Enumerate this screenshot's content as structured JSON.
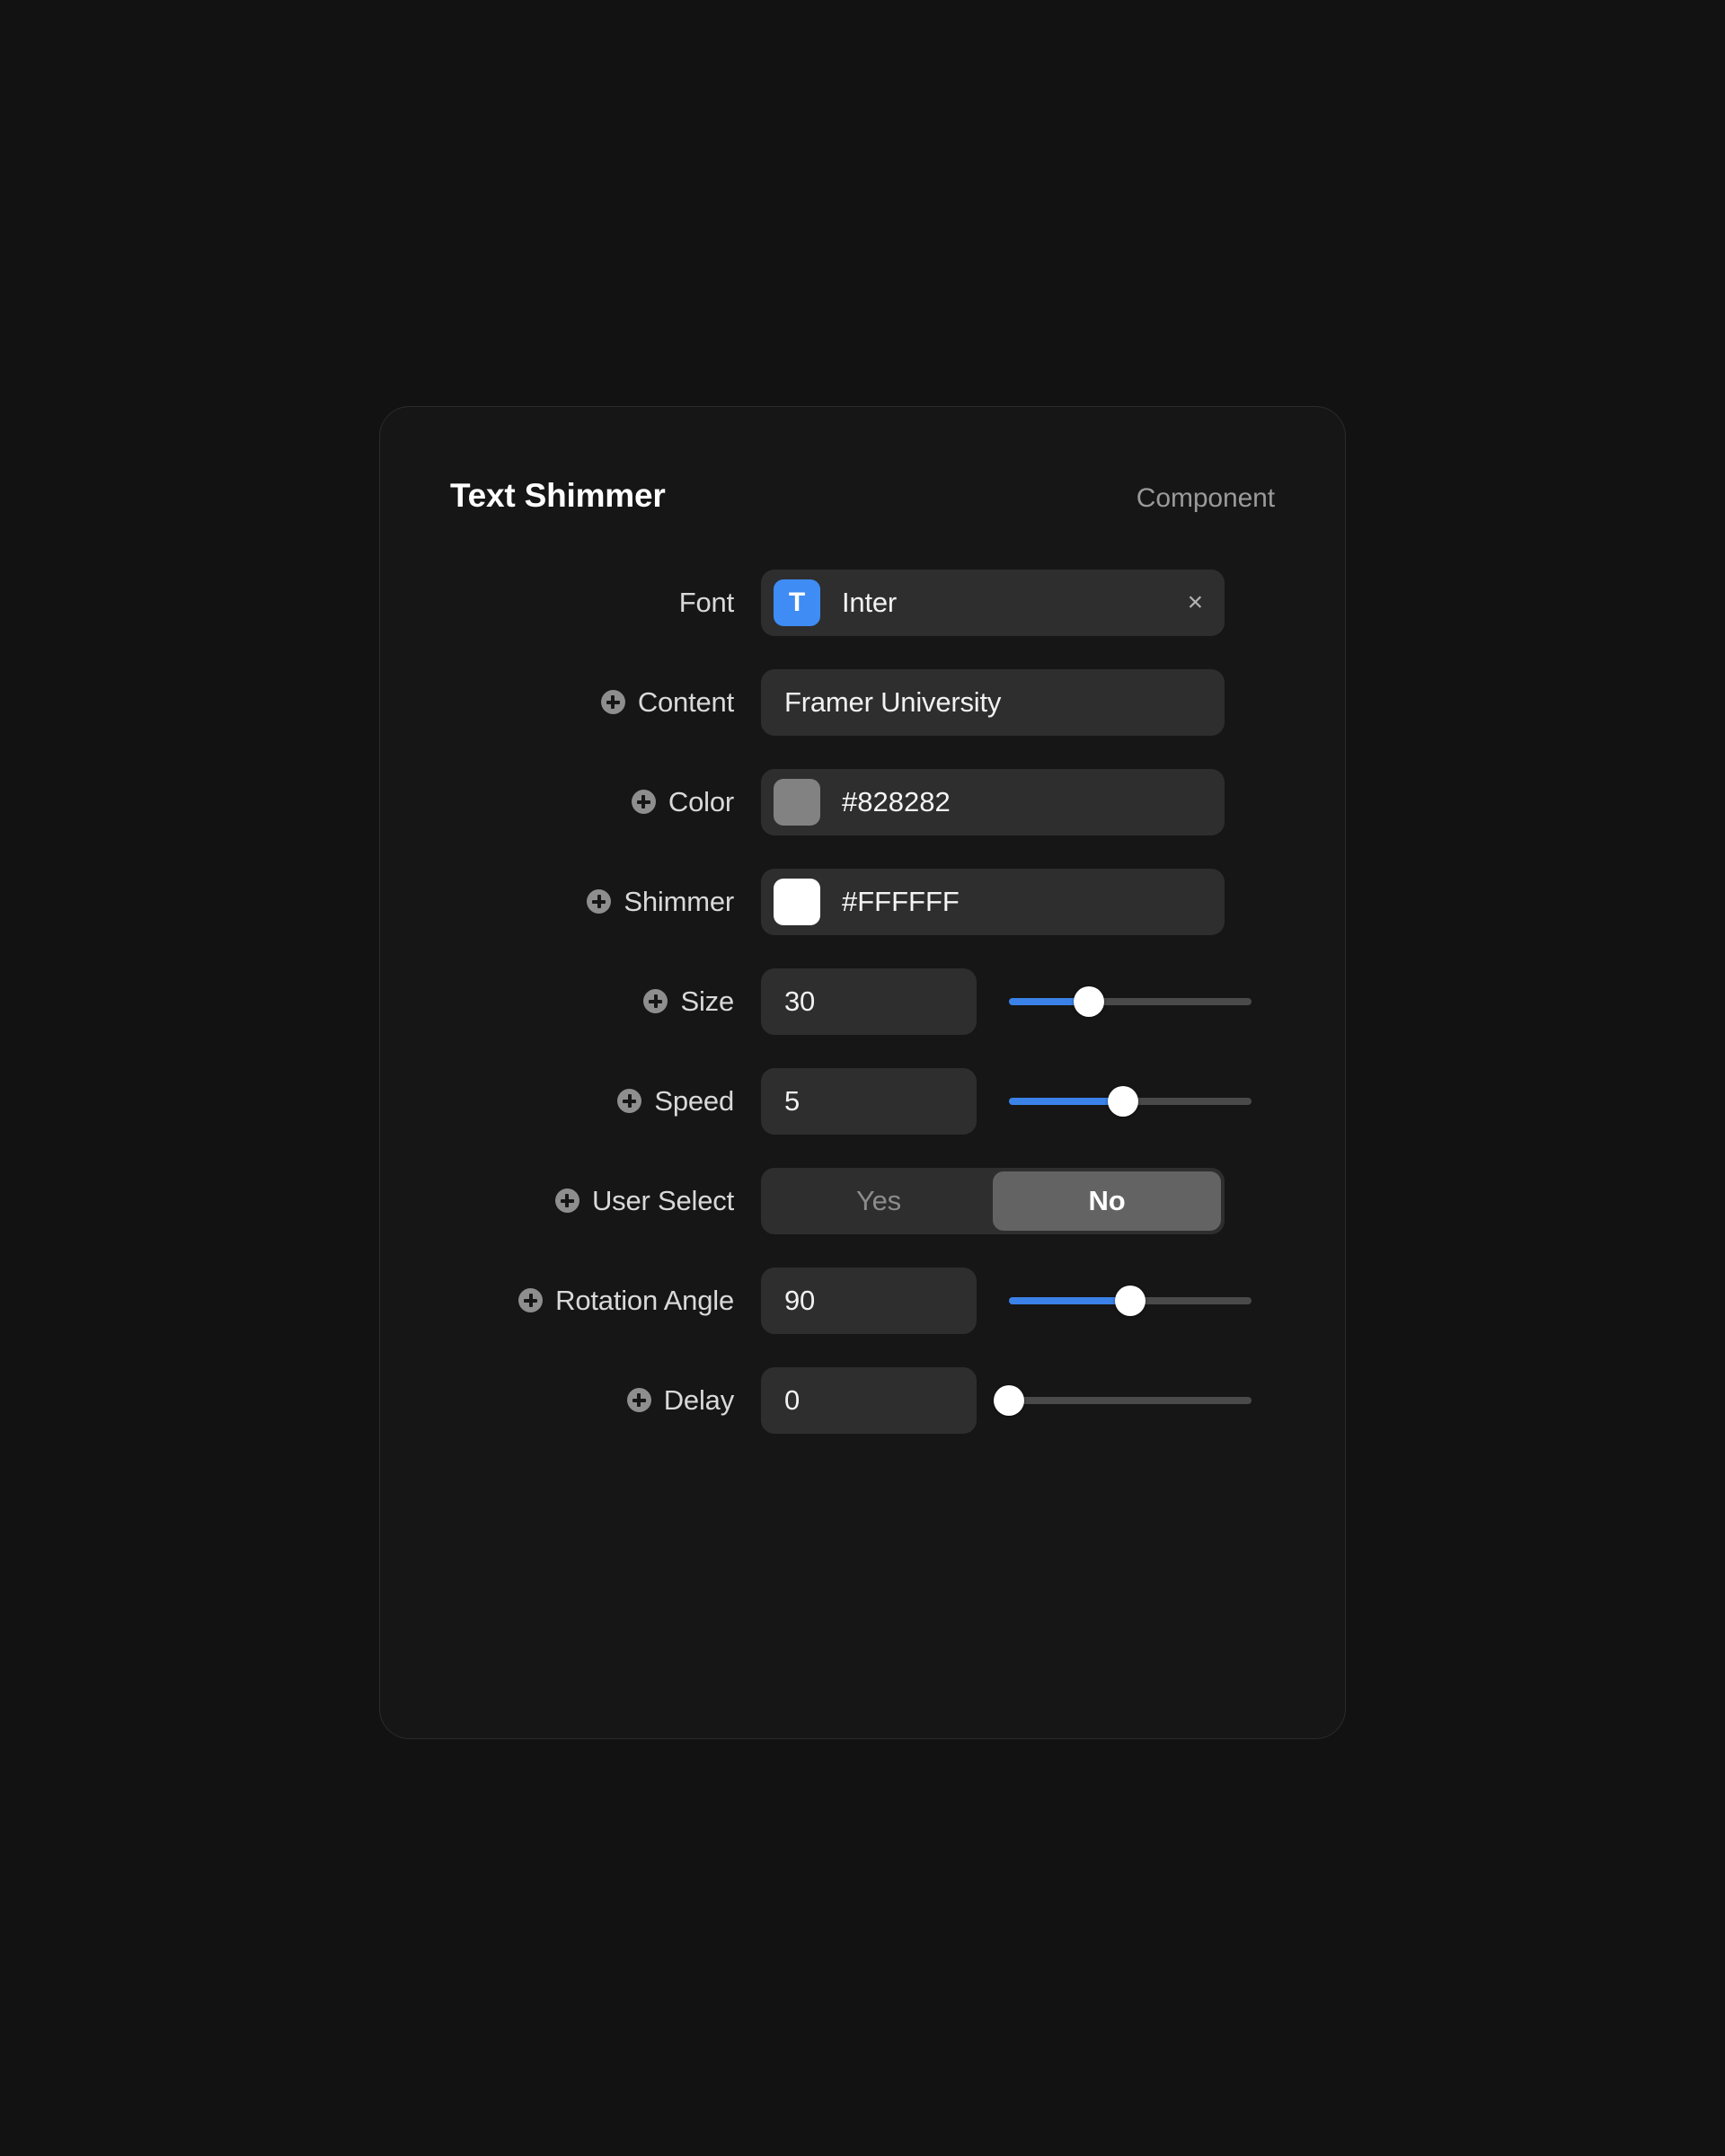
{
  "panel": {
    "title": "Text Shimmer",
    "kind": "Component"
  },
  "rows": {
    "font": {
      "label": "Font",
      "icon_glyph": "T",
      "value": "Inter",
      "clear_glyph": "×",
      "swatch_color": "#3F8CF4"
    },
    "content": {
      "label": "Content",
      "value": "Framer University"
    },
    "color": {
      "label": "Color",
      "value": "#828282",
      "swatch_color": "#828282"
    },
    "shimmer": {
      "label": "Shimmer",
      "value": "#FFFFFF",
      "swatch_color": "#FFFFFF"
    },
    "size": {
      "label": "Size",
      "value": "30",
      "slider_percent": 33
    },
    "speed": {
      "label": "Speed",
      "value": "5",
      "slider_percent": 47
    },
    "user_select": {
      "label": "User Select",
      "options": [
        "Yes",
        "No"
      ],
      "selected": "No"
    },
    "rotation_angle": {
      "label": "Rotation Angle",
      "value": "90",
      "slider_percent": 50
    },
    "delay": {
      "label": "Delay",
      "value": "0",
      "slider_percent": 0
    }
  },
  "colors": {
    "accent": "#3B82E8",
    "panel_bg": "#161616",
    "page_bg": "#121212",
    "field_bg": "#2E2E2E",
    "segment_selected_bg": "#636363"
  }
}
